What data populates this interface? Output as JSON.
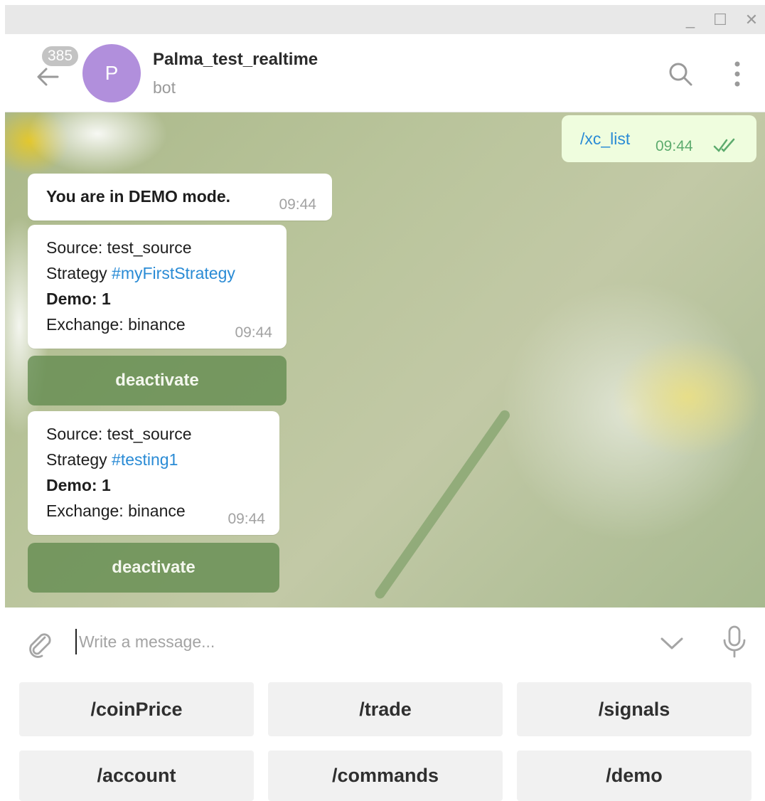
{
  "window": {
    "controls": [
      "_",
      "☐",
      "✕"
    ]
  },
  "header": {
    "unread_badge": "385",
    "avatar_letter": "P",
    "chat_name": "Palma_test_realtime",
    "chat_status": "bot"
  },
  "messages": {
    "outgoing": {
      "text": "/xc_list",
      "time": "09:44"
    },
    "demo_notice": {
      "text": "You are in DEMO mode.",
      "time": "09:44"
    },
    "strategy1": {
      "source": "Source: test_source",
      "strategy_label": "Strategy ",
      "strategy_tag": "#myFirstStrategy",
      "demo": "Demo: 1",
      "exchange": "Exchange: binance",
      "time": "09:44",
      "button": "deactivate"
    },
    "strategy2": {
      "source": "Source: test_source",
      "strategy_label": "Strategy ",
      "strategy_tag": "#testing1",
      "demo": "Demo: 1",
      "exchange": "Exchange: binance",
      "time": "09:44",
      "button": "deactivate"
    }
  },
  "composer": {
    "placeholder": "Write a message..."
  },
  "keyboard": {
    "row1": [
      "/coinPrice",
      "/trade",
      "/signals"
    ],
    "row2": [
      "/account",
      "/commands",
      "/demo"
    ]
  },
  "colors": {
    "accent_link": "#2a8bd5",
    "avatar": "#b18fdc",
    "outgoing_bubble": "#effdde",
    "inline_button": "#628a4e"
  }
}
